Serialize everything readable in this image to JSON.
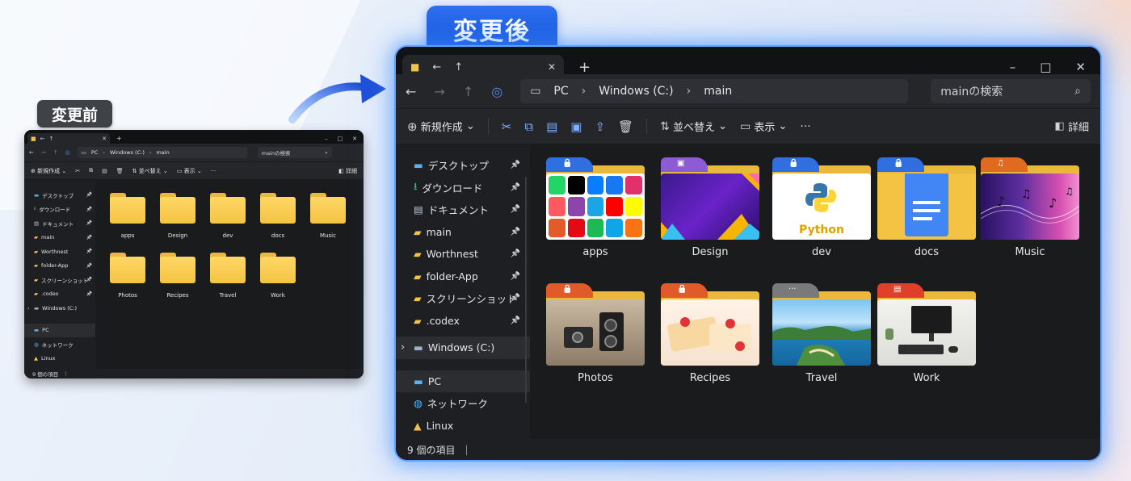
{
  "labels": {
    "before": "変更前",
    "after": "変更後"
  },
  "colors": {
    "accent": "#1a5fe6",
    "folder": "#f4c343",
    "glow": "#5fa2ff"
  },
  "small": {
    "nav": {
      "path_pc": "PC",
      "path_drive": "Windows (C:)",
      "path_folder": "main",
      "search_placeholder": "mainの検索"
    },
    "cmd": {
      "new": "新規作成",
      "sort": "並べ替え",
      "view": "表示",
      "details": "詳細"
    },
    "sidebar": [
      {
        "label": "デスクトップ",
        "icon": "desktop-icon",
        "pinned": true
      },
      {
        "label": "ダウンロード",
        "icon": "download-icon",
        "pinned": true
      },
      {
        "label": "ドキュメント",
        "icon": "document-icon",
        "pinned": true
      },
      {
        "label": "main",
        "icon": "folder-icon",
        "pinned": true
      },
      {
        "label": "Worthnest",
        "icon": "folder-icon",
        "pinned": true
      },
      {
        "label": "folder-App",
        "icon": "folder-icon",
        "pinned": true
      },
      {
        "label": "スクリーンショット",
        "icon": "folder-icon",
        "pinned": true
      },
      {
        "label": ".codex",
        "icon": "folder-icon",
        "pinned": true
      },
      {
        "label": "Windows (C:)",
        "icon": "drive-icon",
        "pinned": false
      },
      {
        "label": "PC",
        "icon": "pc-icon",
        "pinned": false
      },
      {
        "label": "ネットワーク",
        "icon": "network-icon",
        "pinned": false
      },
      {
        "label": "Linux",
        "icon": "linux-icon",
        "pinned": false
      }
    ],
    "folders": [
      "apps",
      "Design",
      "dev",
      "docs",
      "Music",
      "Photos",
      "Recipes",
      "Travel",
      "Work"
    ],
    "status": "9 個の項目"
  },
  "big": {
    "nav": {
      "path_pc": "PC",
      "path_drive": "Windows (C:)",
      "path_folder": "main",
      "search_placeholder": "mainの検索"
    },
    "cmd": {
      "new": "新規作成",
      "sort": "並べ替え",
      "view": "表示",
      "details": "詳細"
    },
    "sidebar": [
      {
        "label": "デスクトップ",
        "icon": "desktop-icon",
        "pinned": true
      },
      {
        "label": "ダウンロード",
        "icon": "download-icon",
        "pinned": true
      },
      {
        "label": "ドキュメント",
        "icon": "document-icon",
        "pinned": true
      },
      {
        "label": "main",
        "icon": "folder-icon",
        "pinned": true
      },
      {
        "label": "Worthnest",
        "icon": "folder-icon",
        "pinned": true
      },
      {
        "label": "folder-App",
        "icon": "folder-icon",
        "pinned": true
      },
      {
        "label": "スクリーンショット",
        "icon": "folder-icon",
        "pinned": true
      },
      {
        "label": ".codex",
        "icon": "folder-icon",
        "pinned": true
      }
    ],
    "drive": "Windows (C:)",
    "bottom": [
      {
        "label": "PC",
        "icon": "pc-icon"
      },
      {
        "label": "ネットワーク",
        "icon": "network-icon"
      },
      {
        "label": "Linux",
        "icon": "linux-icon"
      }
    ],
    "folders": [
      {
        "name": "apps",
        "tab_color": "#2f6fe0",
        "badge": "lock-icon",
        "art": "apps"
      },
      {
        "name": "Design",
        "tab_color": "#8e5bd6",
        "badge": "image-icon",
        "art": "design"
      },
      {
        "name": "dev",
        "tab_color": "#2f6fe0",
        "badge": "lock-icon",
        "art": "python"
      },
      {
        "name": "docs",
        "tab_color": "#2f6fe0",
        "badge": "lock-icon",
        "art": "docs"
      },
      {
        "name": "Music",
        "tab_color": "#e06a1f",
        "badge": "music-icon",
        "art": "music"
      },
      {
        "name": "Photos",
        "tab_color": "#e05a2a",
        "badge": "lock-icon",
        "art": "photos"
      },
      {
        "name": "Recipes",
        "tab_color": "#e05a2a",
        "badge": "lock-icon",
        "art": "recipes"
      },
      {
        "name": "Travel",
        "tab_color": "#7a7a7a",
        "badge": "more-icon",
        "art": "travel"
      },
      {
        "name": "Work",
        "tab_color": "#e0402a",
        "badge": "box-icon",
        "art": "work"
      }
    ],
    "python_text": "Python",
    "status": "9 個の項目"
  }
}
